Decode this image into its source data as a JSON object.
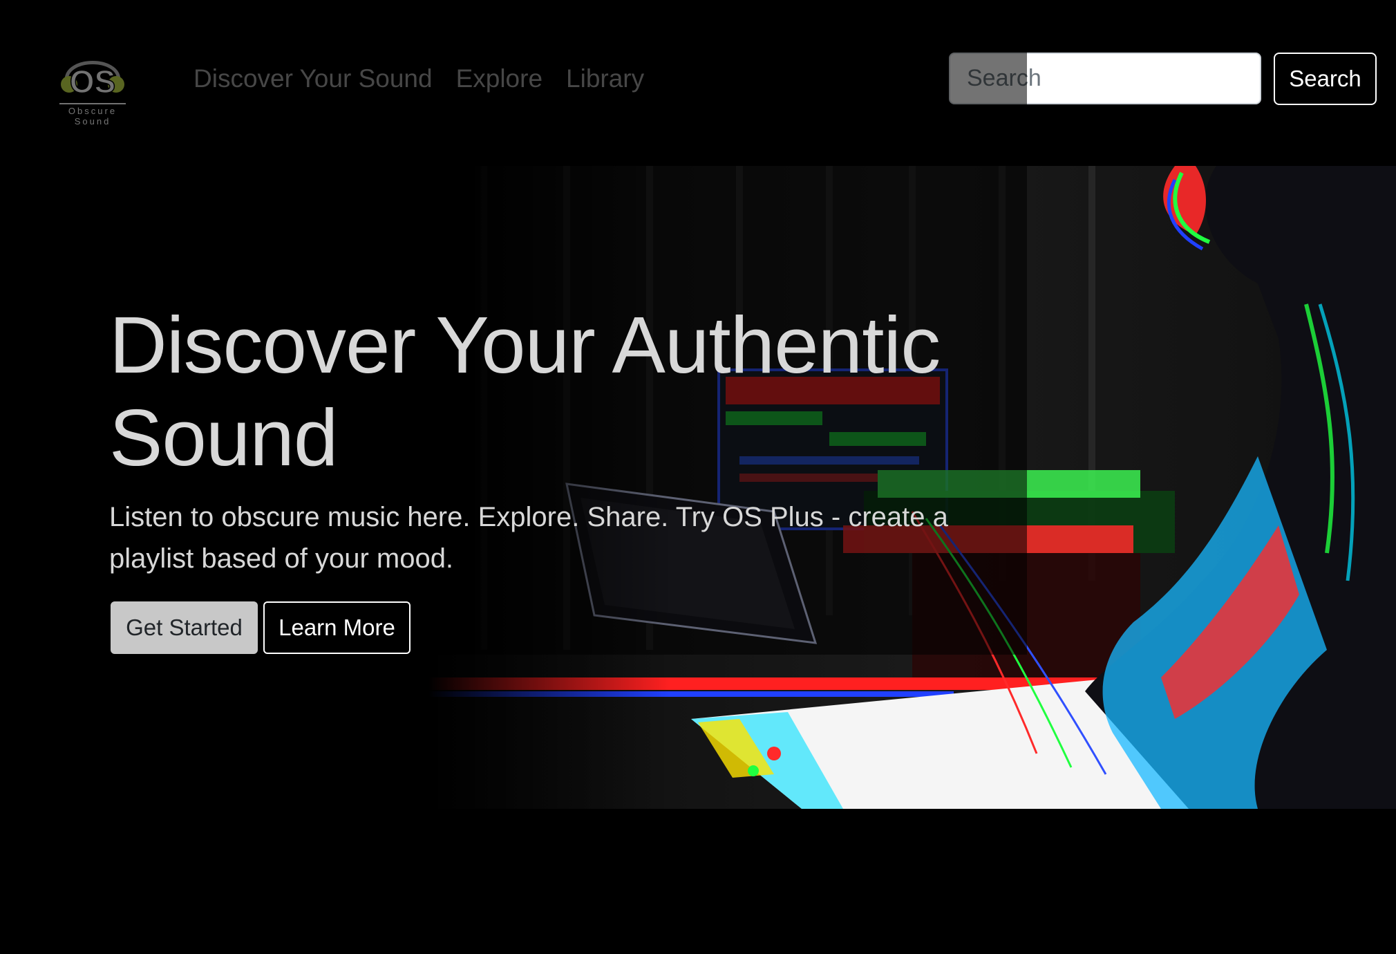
{
  "brand": {
    "logo_text": "OS",
    "logo_caption_line1": "Obscure",
    "logo_caption_line2": "Sound",
    "accent_color": "#c5e04a"
  },
  "nav": {
    "items": [
      {
        "label": "Discover Your Sound"
      },
      {
        "label": "Explore"
      },
      {
        "label": "Library"
      }
    ]
  },
  "search": {
    "placeholder": "Search",
    "value": "",
    "button_label": "Search"
  },
  "hero": {
    "heading": "Discover Your Authentic Sound",
    "text": "Listen to obscure music here. Explore. Share. Try OS Plus - create a playlist based of your mood.",
    "primary_button": "Get Started",
    "secondary_button": "Learn More",
    "image_subject": "musician-playing-keyboard-glitch-photo"
  }
}
